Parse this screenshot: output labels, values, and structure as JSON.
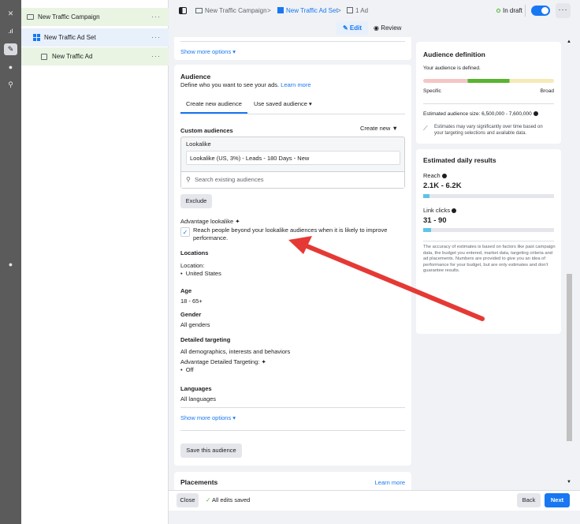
{
  "tree": {
    "campaign": "New Traffic Campaign",
    "adset": "New Traffic Ad Set",
    "ad": "New Traffic Ad"
  },
  "breadcrumb": {
    "campaign": "New Traffic Campaign",
    "adset": "New Traffic Ad Set",
    "ad_count": "1 Ad",
    "status": "In draft",
    "edit": "Edit",
    "review": "Review"
  },
  "main": {
    "show_more_top": "Show more options ▾",
    "audience_title": "Audience",
    "audience_desc": "Define who you want to see your ads.",
    "learn_more": "Learn more",
    "tab_create": "Create new audience",
    "tab_saved": "Use saved audience ▾",
    "custom_audiences": "Custom audiences",
    "create_new": "Create new",
    "lookalike_header": "Lookalike",
    "lookalike_item": "Lookalike (US, 3%) - Leads - 180 Days - New",
    "search_placeholder": "Search existing audiences",
    "exclude": "Exclude",
    "adv_lookalike": "Advantage lookalike",
    "adv_lookalike_text": "Reach people beyond your lookalike audiences when it is likely to improve performance.",
    "locations_label": "Locations",
    "location_sub": "Location:",
    "location_value": "United States",
    "age_label": "Age",
    "age_value": "18 - 65+",
    "gender_label": "Gender",
    "gender_value": "All genders",
    "detailed_label": "Detailed targeting",
    "detailed_value": "All demographics, interests and behaviors",
    "adv_detailed": "Advantage Detailed Targeting:",
    "adv_detailed_value": "Off",
    "languages_label": "Languages",
    "languages_value": "All languages",
    "show_more_bottom": "Show more options ▾",
    "save_audience": "Save this audience",
    "placements_label": "Placements",
    "placements_learn": "Learn more"
  },
  "side": {
    "def_title": "Audience definition",
    "def_status": "Your audience is defined.",
    "specific": "Specific",
    "broad": "Broad",
    "size": "Estimated audience size: 6,500,000 - 7,600,000",
    "note": "Estimates may vary significantly over time based on your targeting selections and available data.",
    "est_title": "Estimated daily results",
    "reach_label": "Reach",
    "reach_value": "2.1K - 6.2K",
    "reach_level": 0.05,
    "clicks_label": "Link clicks",
    "clicks_value": "31 - 90",
    "clicks_level": 0.06,
    "disclaimer": "The accuracy of estimates is based on factors like past campaign data, the budget you entered, market data, targeting criteria and ad placements. Numbers are provided to give you an idea of performance for your budget, but are only estimates and don't guarantee results."
  },
  "footer": {
    "close": "Close",
    "saved": "All edits saved",
    "back": "Back",
    "next": "Next"
  },
  "colors": {
    "accent": "#1877f2",
    "annotation_arrow": "#e53935",
    "meter_green": "#58b430",
    "meter_red": "#f5c6c6",
    "meter_yellow": "#f7e9b8",
    "status_green": "#42b72a"
  }
}
